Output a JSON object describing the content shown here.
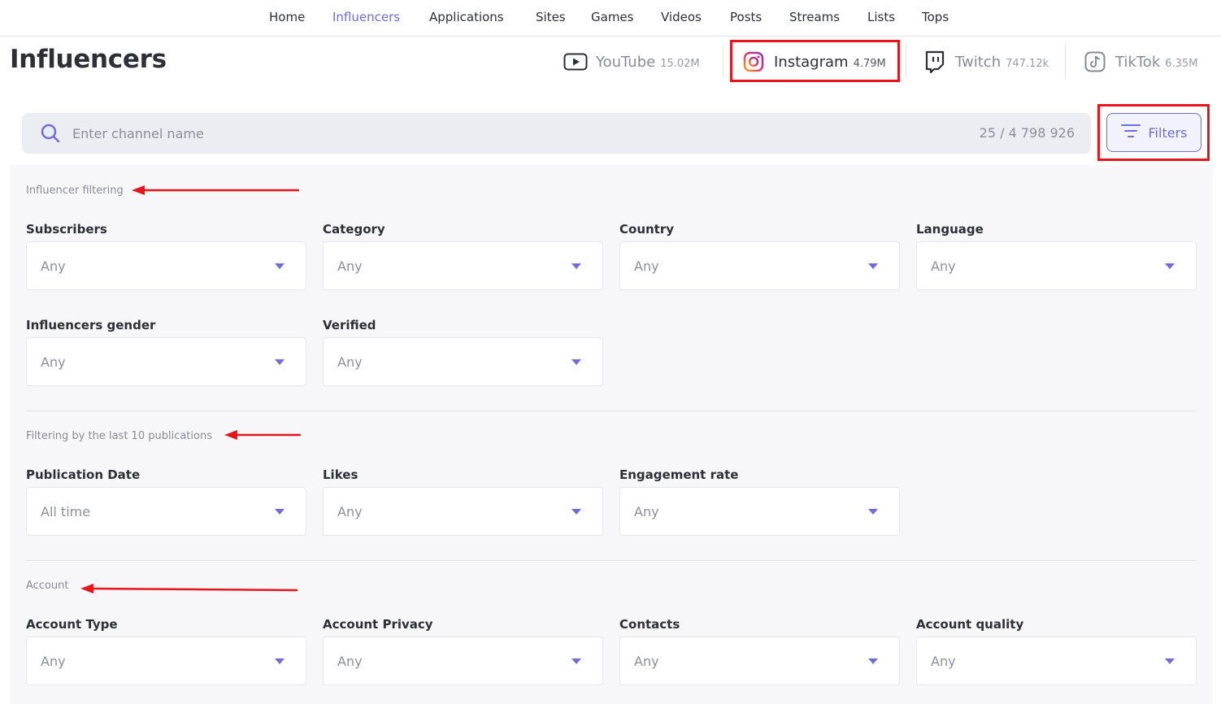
{
  "nav": {
    "items": [
      {
        "label": "Home",
        "active": false
      },
      {
        "label": "Influencers",
        "active": true
      },
      {
        "label": "Applications",
        "active": false
      },
      {
        "label": "Sites",
        "active": false
      },
      {
        "label": "Games",
        "active": false
      },
      {
        "label": "Videos",
        "active": false
      },
      {
        "label": "Posts",
        "active": false
      },
      {
        "label": "Streams",
        "active": false
      },
      {
        "label": "Lists",
        "active": false
      },
      {
        "label": "Tops",
        "active": false
      }
    ]
  },
  "header": {
    "title": "Influencers",
    "platforms": [
      {
        "name": "YouTube",
        "count": "15.02M",
        "icon": "youtube-icon",
        "active": false
      },
      {
        "name": "Instagram",
        "count": "4.79M",
        "icon": "instagram-icon",
        "active": true
      },
      {
        "name": "Twitch",
        "count": "747.12k",
        "icon": "twitch-icon",
        "active": false
      },
      {
        "name": "TikTok",
        "count": "6.35M",
        "icon": "tiktok-icon",
        "active": false
      }
    ]
  },
  "search": {
    "placeholder": "Enter channel name",
    "value": "",
    "count": "25 / 4 798 926",
    "filters_label": "Filters"
  },
  "filters": {
    "influencer_section": "Influencer filtering",
    "subscribers": {
      "label": "Subscribers",
      "value": "Any"
    },
    "category": {
      "label": "Category",
      "value": "Any"
    },
    "country": {
      "label": "Country",
      "value": "Any"
    },
    "language": {
      "label": "Language",
      "value": "Any"
    },
    "gender": {
      "label": "Influencers gender",
      "value": "Any"
    },
    "verified": {
      "label": "Verified",
      "value": "Any"
    },
    "publications_section": "Filtering by the last 10 publications",
    "publication_date": {
      "label": "Publication Date",
      "value": "All time"
    },
    "likes": {
      "label": "Likes",
      "value": "Any"
    },
    "engagement": {
      "label": "Engagement rate",
      "value": "Any"
    },
    "account_section": "Account",
    "account_type": {
      "label": "Account Type",
      "value": "Any"
    },
    "account_privacy": {
      "label": "Account Privacy",
      "value": "Any"
    },
    "contacts": {
      "label": "Contacts",
      "value": "Any"
    },
    "account_quality": {
      "label": "Account quality",
      "value": "Any"
    }
  },
  "colors": {
    "accent": "#6c6cdc",
    "highlight": "#e8141c",
    "panel_bg": "#f7f7f9"
  }
}
